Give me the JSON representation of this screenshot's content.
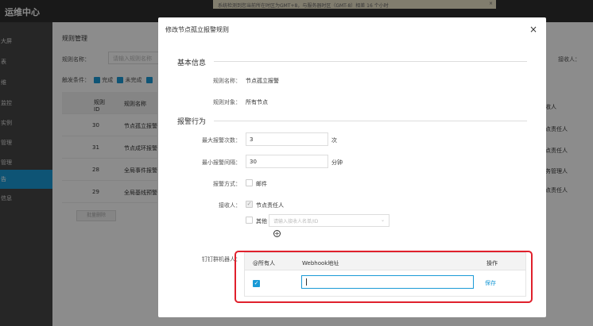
{
  "app": {
    "title": "运维中心"
  },
  "notice": {
    "text": "系统检测到您当前所在时区为GMT+8，与服务器时区（GMT-8）相差 16 个小时",
    "close": "×"
  },
  "sidebar": {
    "items": [
      {
        "label": "大屏",
        "active": false
      },
      {
        "label": "表",
        "active": false
      },
      {
        "label": "维",
        "active": false
      },
      {
        "label": "监控",
        "active": false
      },
      {
        "label": "实例",
        "active": false
      },
      {
        "label": "管理",
        "active": false
      },
      {
        "label": "管理",
        "active": false
      },
      {
        "label": "告",
        "active": true
      },
      {
        "label": "信息",
        "active": false
      }
    ]
  },
  "main": {
    "title": "规则管理",
    "filter_label": "规则名称：",
    "filter_placeholder": "请输入规则名称",
    "trigger_label": "触发条件：",
    "trigger_options": [
      "完成",
      "未完成"
    ],
    "receiver_label": "接收人：",
    "table": {
      "headers": [
        "规则ID",
        "规则名称"
      ],
      "rows": [
        {
          "id": "30",
          "name": "节点孤立报警",
          "receiver": "点责任人"
        },
        {
          "id": "31",
          "name": "节点成环报警",
          "receiver": "点责任人"
        },
        {
          "id": "28",
          "name": "全局事件报警",
          "receiver": "务管理人"
        },
        {
          "id": "29",
          "name": "全局基线预警",
          "receiver": "点责任人"
        }
      ],
      "receiver_header": "收人"
    },
    "batch_button": "批量删除"
  },
  "modal": {
    "title": "修改节点孤立报警规则",
    "close_icon": "×",
    "basic_section": "基本信息",
    "rule_name_label": "规则名称：",
    "rule_name_value": "节点孤立报警",
    "rule_target_label": "规则对象：",
    "rule_target_value": "所有节点",
    "alert_section": "报警行为",
    "max_count_label": "最大报警次数：",
    "max_count_value": "3",
    "max_count_unit": "次",
    "min_interval_label": "最小报警间隔：",
    "min_interval_value": "30",
    "min_interval_unit": "分钟",
    "method_label": "报警方式：",
    "method_option": "邮件",
    "receiver_label": "接收人：",
    "receiver_fixed": "节点责任人",
    "receiver_other": "其他",
    "receiver_placeholder": "请输入接收人名单/ID",
    "add_icon": "⊕",
    "robot_label": "钉钉群机器人：",
    "robot_table": {
      "col_at_all": "@所有人",
      "col_webhook": "Webhook地址",
      "col_action": "操作",
      "row_save": "保存"
    }
  }
}
